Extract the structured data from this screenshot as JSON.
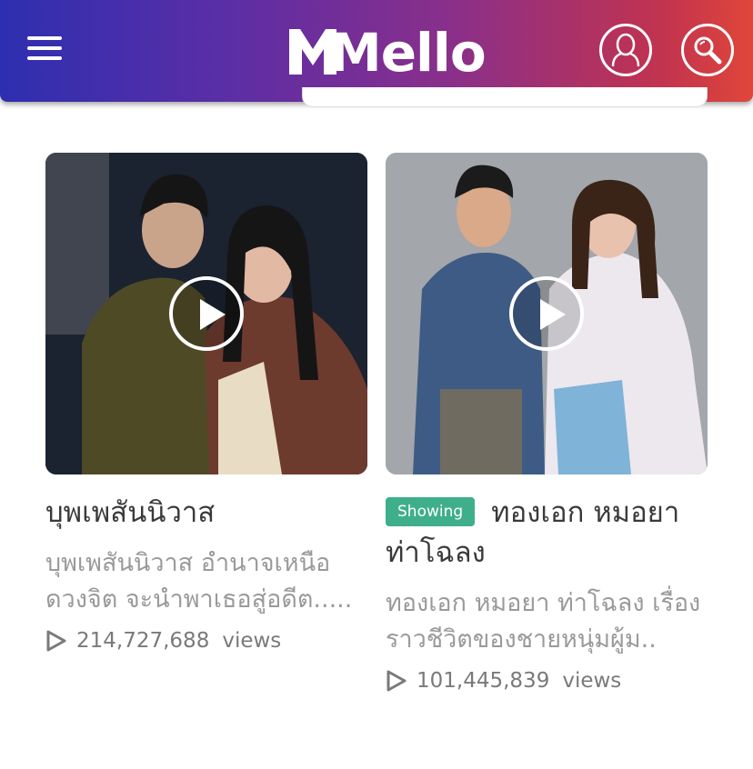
{
  "header": {
    "brand": "Mello",
    "logo_letter": "M",
    "colors": {
      "gradient_start": "#2d2fb0",
      "gradient_end": "#e0463a"
    },
    "icons": [
      "menu-icon",
      "user-icon",
      "search-icon"
    ]
  },
  "cards": [
    {
      "title": "บุพเพสันนิวาส",
      "description": "บุพเพสันนิวาส อำนาจเหนือดวงจิต จะนำพาเธอสู่อดีต.....",
      "views": "214,727,688",
      "views_label": "views",
      "badge": ""
    },
    {
      "title": "ทองเอก หมอยา ท่าโฉลง",
      "description": "ทองเอก หมอยา ท่าโฉลง เรื่องราวชีวิตของชายหนุ่มผู้ม..",
      "views": "101,445,839",
      "views_label": "views",
      "badge": "Showing",
      "badge_color": "#3fae8b"
    }
  ]
}
